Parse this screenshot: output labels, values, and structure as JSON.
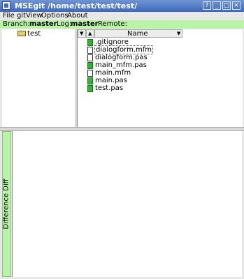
{
  "window": {
    "title": "MSEgit /home/test/test/test/"
  },
  "titlebar_buttons": [
    "?",
    "_",
    "□",
    "×"
  ],
  "menu": [
    {
      "name": "menu-file",
      "label": "File"
    },
    {
      "name": "menu-git",
      "label": "git"
    },
    {
      "name": "menu-view",
      "label": "View"
    },
    {
      "name": "menu-options",
      "label": "Options"
    },
    {
      "name": "menu-about",
      "label": "About"
    }
  ],
  "status": {
    "branch_label": "Branch:",
    "branch_value": "master",
    "log_label": "Log:",
    "log_value": "master",
    "remote_label": "Remote:"
  },
  "tree": {
    "root": "test"
  },
  "filelist": {
    "name_header": "Name",
    "files": [
      {
        "name": ".gitignore",
        "modified": true
      },
      {
        "name": "dialogform.mfm",
        "modified": false,
        "selected": true
      },
      {
        "name": "dialogform.pas",
        "modified": false
      },
      {
        "name": "main_mfm.pas",
        "modified": true
      },
      {
        "name": "main.mfm",
        "modified": false
      },
      {
        "name": "main.pas",
        "modified": true
      },
      {
        "name": "test.pas",
        "modified": true
      }
    ]
  },
  "diff": {
    "tab_label": "Difference Diff"
  },
  "colors": {
    "status_bg": "#b9f4a6",
    "title_bg": "#3c69bd",
    "modified_icon": "#2fb82f"
  }
}
